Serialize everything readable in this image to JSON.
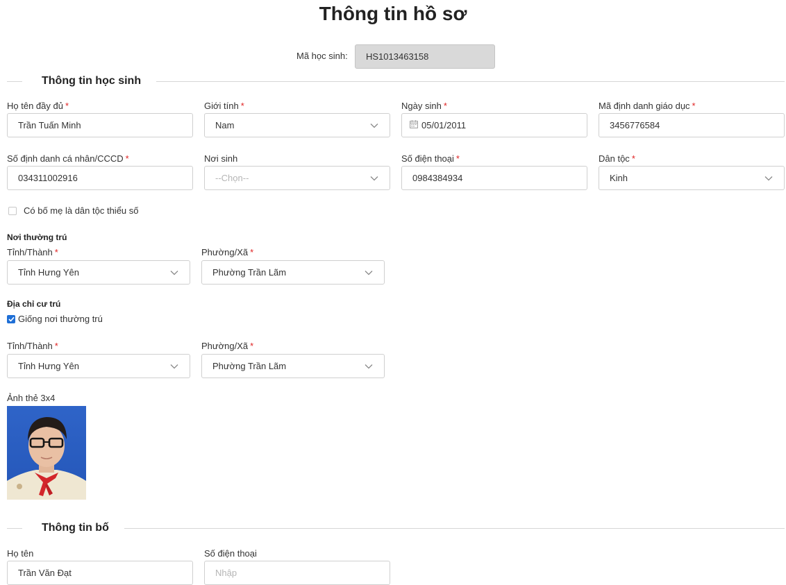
{
  "title": "Thông tin hồ sơ",
  "student_code": {
    "label": "Mã học sinh:",
    "value": "HS1013463158"
  },
  "sections": {
    "student": "Thông tin học sinh",
    "father": "Thông tin bố"
  },
  "student": {
    "full_name": {
      "label": "Họ tên đầy đủ",
      "value": "Trần Tuấn Minh"
    },
    "gender": {
      "label": "Giới tính",
      "value": "Nam"
    },
    "dob": {
      "label": "Ngày sinh",
      "value": "05/01/2011"
    },
    "edu_id": {
      "label": "Mã định danh giáo dục",
      "value": "3456776584"
    },
    "citizen_id": {
      "label": "Số định danh cá nhân/CCCD",
      "value": "034311002916"
    },
    "birthplace": {
      "label": "Nơi sinh",
      "placeholder": "--Chọn--"
    },
    "phone": {
      "label": "Số điện thoại",
      "value": "0984384934"
    },
    "ethnicity": {
      "label": "Dân tộc",
      "value": "Kinh"
    },
    "minority_parent": {
      "label": "Có bố mẹ là dân tộc thiểu số",
      "checked": false
    },
    "permanent": {
      "heading": "Nơi thường trú",
      "province_label": "Tỉnh/Thành",
      "province_value": "Tỉnh Hưng Yên",
      "ward_label": "Phường/Xã",
      "ward_value": "Phường Trần Lãm"
    },
    "residence": {
      "heading": "Địa chỉ cư trú",
      "same_label": "Giống nơi thường trú",
      "same_checked": true,
      "province_label": "Tỉnh/Thành",
      "province_value": "Tỉnh Hưng Yên",
      "ward_label": "Phường/Xã",
      "ward_value": "Phường Trần Lãm"
    },
    "photo_label": "Ảnh thẻ 3x4"
  },
  "father": {
    "name": {
      "label": "Họ tên",
      "value": "Trần Văn Đạt"
    },
    "phone": {
      "label": "Số điện thoại",
      "placeholder": "Nhập"
    }
  },
  "required_mark": "*",
  "icons": {
    "dropdown": "chevron-down-icon",
    "date": "calendar-icon",
    "check": "check-icon"
  },
  "colors": {
    "required": "#e02424",
    "checkbox": "#1f6fd6",
    "readonly_bg": "#d9d9d9"
  }
}
